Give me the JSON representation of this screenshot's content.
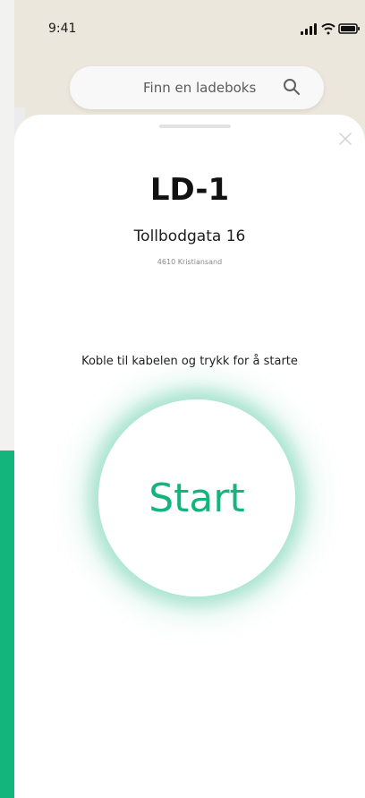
{
  "status_bar": {
    "time": "9:41",
    "icons": [
      "signal-icon",
      "wifi-icon",
      "battery-icon"
    ]
  },
  "search": {
    "placeholder": "Finn en ladeboks",
    "icon": "search-icon"
  },
  "sheet": {
    "close_icon": "close-icon",
    "charger_name": "LD-1",
    "street": "Tollbodgata 16",
    "postal": "4610 Kristiansand",
    "instruction": "Koble til kabelen og trykk for å starte",
    "start_label": "Start"
  },
  "colors": {
    "accent": "#13b57c",
    "top_background": "#ece7dc",
    "sheet_background": "#ffffff"
  }
}
